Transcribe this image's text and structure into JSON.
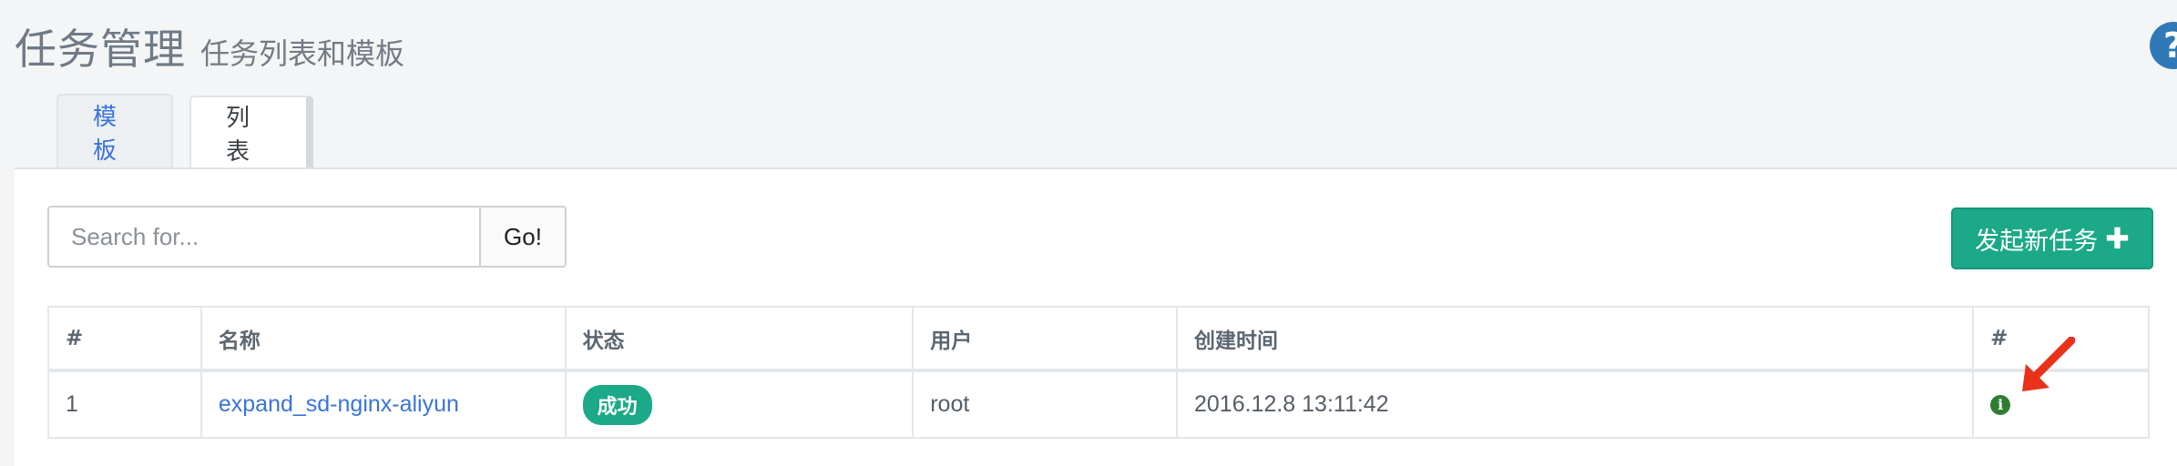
{
  "header": {
    "title": "任务管理",
    "subtitle": "任务列表和模板",
    "help_icon": "?"
  },
  "tabs": [
    {
      "label": "模板",
      "active": false
    },
    {
      "label": "列表",
      "active": true
    }
  ],
  "search": {
    "placeholder": "Search for...",
    "value": "",
    "button_label": "Go!"
  },
  "new_task_button": {
    "label": "发起新任务",
    "icon": "plus-icon"
  },
  "table": {
    "headers": [
      "#",
      "名称",
      "状态",
      "用户",
      "创建时间",
      "#"
    ],
    "rows": [
      {
        "index": "1",
        "name": "expand_sd-nginx-aliyun",
        "status": "成功",
        "user": "root",
        "created_at": "2016.12.8 13:11:42",
        "action_icon": "i"
      }
    ]
  },
  "colors": {
    "accent_green": "#1ba987",
    "link_blue": "#3b73d9",
    "help_blue": "#2f79b8",
    "annotation_red": "#e8321a"
  }
}
